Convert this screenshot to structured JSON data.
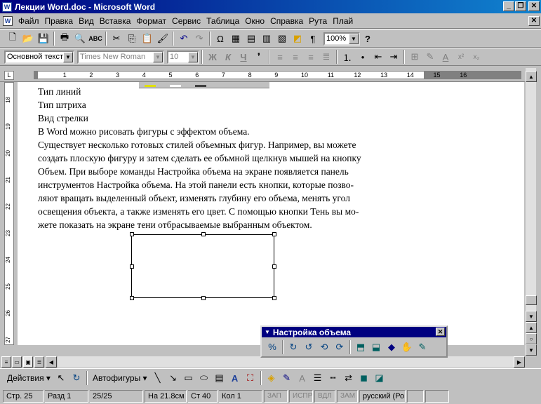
{
  "window": {
    "title": "Лекции Word.doc - Microsoft Word"
  },
  "menu": [
    "Файл",
    "Правка",
    "Вид",
    "Вставка",
    "Формат",
    "Сервис",
    "Таблица",
    "Окно",
    "Справка",
    "Рута",
    "Плай"
  ],
  "standard_toolbar": {
    "zoom": "100%"
  },
  "format_toolbar": {
    "style": "Основной текст",
    "font": "Times New Roman",
    "size": "10",
    "bold": "Ж",
    "italic": "К",
    "underline": "Ч"
  },
  "ruler": {
    "h_ticks": [
      "1",
      "2",
      "3",
      "4",
      "5",
      "6",
      "7",
      "8",
      "9",
      "10",
      "11",
      "12",
      "13",
      "14",
      "15",
      "16"
    ],
    "v_ticks": [
      "18",
      "19",
      "20",
      "21",
      "22",
      "23",
      "24",
      "25",
      "26",
      "27"
    ]
  },
  "document": {
    "lines": [
      "Тип линий",
      "Тип штриха",
      "Вид стрелки",
      "В Word можно рисовать фигуры с эффектом объема."
    ],
    "paragraph": [
      "Существует несколько готовых стилей объемных фигур. Например, вы можете",
      "создать плоскую фигуру и затем сделать ее объмной щелкнув мышей на кнопку",
      "Объем. При выборе команды Настройка объема на экране появляется панель",
      "инструментов Настройка объема.  На этой панели есть кнопки, которые позво-",
      "ляют вращать выделенный объект, изменять глубину его объема, менять угол",
      "освещения объекта, а также изменять его цвет. С помощью кнопки Тень вы мо-",
      "жете показать на экране тени отбрасываемые выбранным объектом."
    ]
  },
  "float_toolbar": {
    "title": "Настройка объема"
  },
  "drawing_toolbar": {
    "actions": "Действия",
    "autoshapes": "Автофигуры"
  },
  "statusbar": {
    "page": "Стр. 25",
    "section": "Разд 1",
    "pages": "25/25",
    "at": "На 21.8см",
    "line": "Ст 40",
    "col": "Кол 1",
    "rec": "ЗАП",
    "trk": "ИСПР",
    "ext": "ВДЛ",
    "ovr": "ЗАМ",
    "lang": "русский (Ро"
  }
}
